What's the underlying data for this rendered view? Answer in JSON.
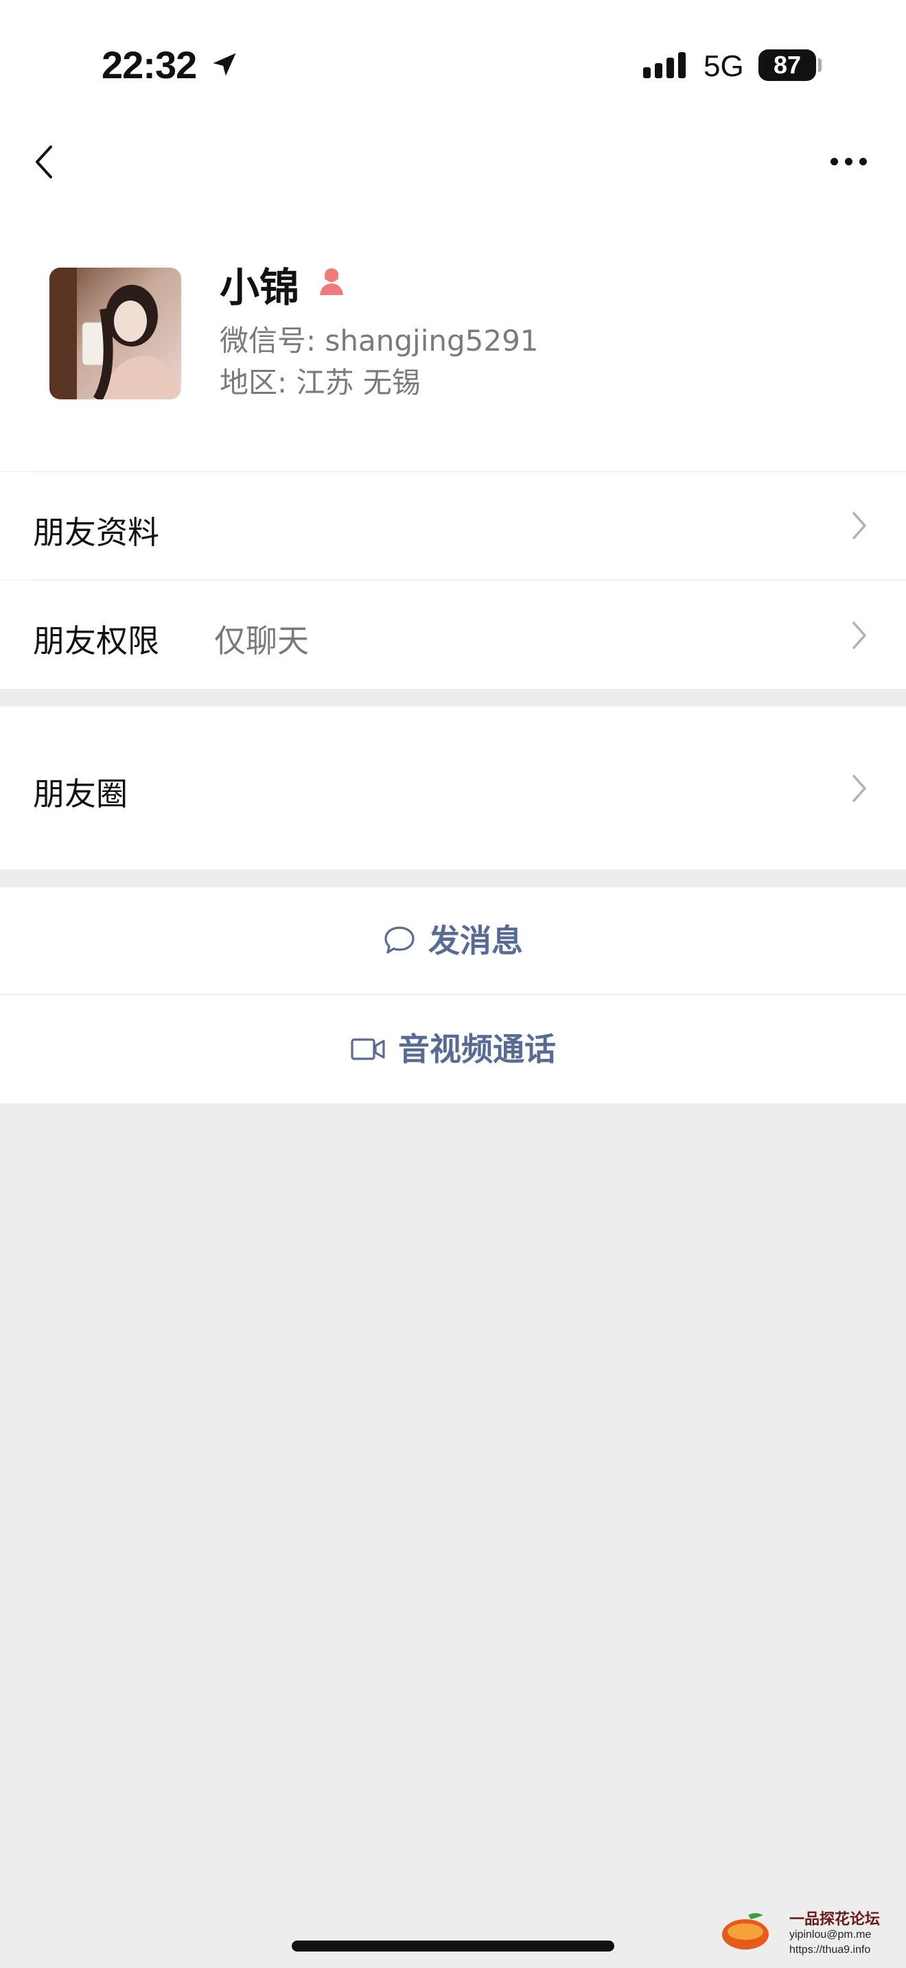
{
  "status_bar": {
    "time": "22:32",
    "network": "5G",
    "battery": "87"
  },
  "nav": {
    "back_icon": "chevron-left-icon",
    "more_icon": "more-dots-icon"
  },
  "profile": {
    "name": "小锦",
    "wechat_id": "微信号: shangjing5291",
    "region": "地区: 江苏 无锡",
    "gender_icon": "female-icon",
    "gender_color": "#f07a7a"
  },
  "rows": [
    {
      "label": "朋友资料",
      "value": ""
    },
    {
      "label": "朋友权限",
      "value": "仅聊天"
    },
    {
      "label": "朋友圈",
      "value": ""
    }
  ],
  "actions": {
    "message": "发消息",
    "call": "音视频通话"
  },
  "colors": {
    "link": "#576b95",
    "background": "#ededed"
  },
  "watermark": {
    "title": "一品探花论坛",
    "email": "yipinlou@pm.me",
    "url": "https://thua9.info"
  }
}
